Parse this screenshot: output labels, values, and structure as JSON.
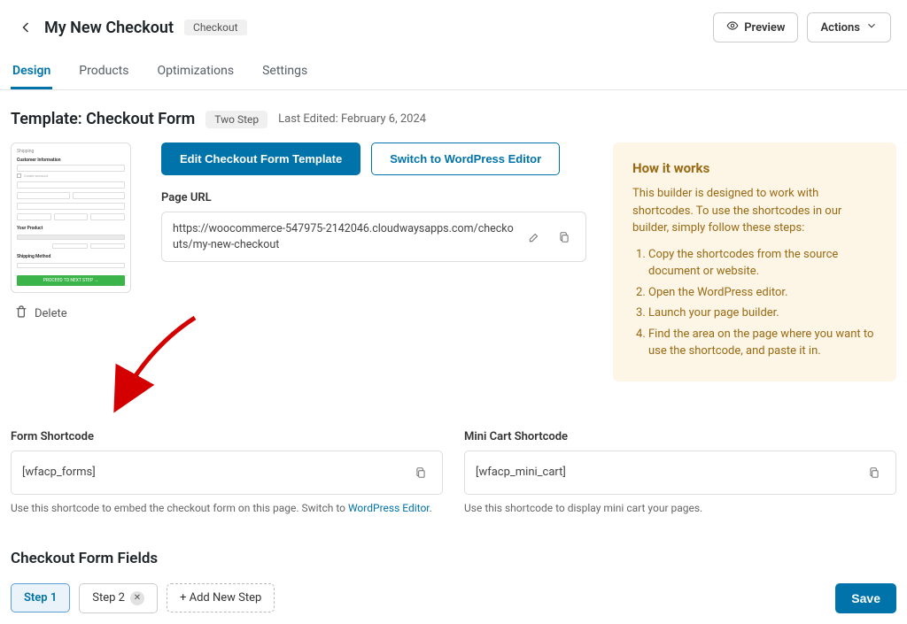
{
  "header": {
    "title": "My New Checkout",
    "badge": "Checkout",
    "preview_label": "Preview",
    "actions_label": "Actions"
  },
  "tabs": {
    "design": "Design",
    "products": "Products",
    "optimizations": "Optimizations",
    "settings": "Settings"
  },
  "subheader": {
    "title": "Template: Checkout Form",
    "chip": "Two Step",
    "last_edited": "Last Edited: February 6, 2024"
  },
  "thumbnail": {
    "shipping": "Shipping",
    "ci": "Customer Information",
    "yp": "Your Product",
    "sm": "Shipping Method",
    "next": "PROCEED TO NEXT STEP →",
    "delete_label": "Delete"
  },
  "mid": {
    "edit_btn": "Edit Checkout Form Template",
    "switch_btn": "Switch to WordPress Editor",
    "page_url_label": "Page URL",
    "page_url": "https://woocommerce-547975-2142046.cloudwaysapps.com/checkouts/my-new-checkout"
  },
  "howitworks": {
    "title": "How it works",
    "desc": "This builder is designed to work with shortcodes. To use the shortcodes in our builder, simply follow these steps:",
    "steps": [
      "Copy the shortcodes from the source document or website.",
      "Open the WordPress editor.",
      "Launch your page builder.",
      "Find the area on the page where you want to use the shortcode, and paste it in."
    ]
  },
  "shortcodes": {
    "form": {
      "label": "Form Shortcode",
      "value": "[wfacp_forms]",
      "help_pre": "Use this shortcode to embed the checkout form on this page. Switch to ",
      "help_link": "WordPress Editor",
      "help_post": "."
    },
    "mini": {
      "label": "Mini Cart Shortcode",
      "value": "[wfacp_mini_cart]",
      "help": "Use this shortcode to display mini cart your pages."
    }
  },
  "formfields": {
    "title": "Checkout Form Fields",
    "step1": "Step 1",
    "step2": "Step 2",
    "addstep": "+ Add New Step",
    "save": "Save"
  }
}
